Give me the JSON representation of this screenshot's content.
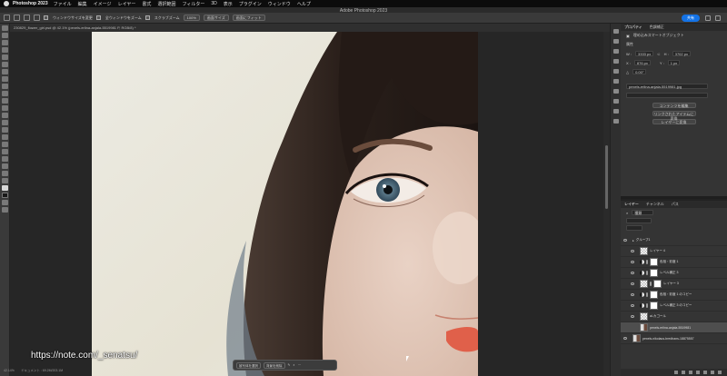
{
  "menubar": {
    "app": "Photoshop 2023",
    "items": [
      "ファイル",
      "編集",
      "イメージ",
      "レイヤー",
      "書式",
      "選択範囲",
      "フィルター",
      "3D",
      "表示",
      "プラグイン",
      "ウィンドウ",
      "ヘルプ"
    ]
  },
  "window": {
    "title": "Adobe Photoshop 2023"
  },
  "options": {
    "resize_windows": "ウィンドウサイズを変更",
    "zoom_all": "全ウィンドウをズーム",
    "scrubby_zoom": "スクラブズーム",
    "zoom_percent": "100%",
    "fit_screen": "画面サイズ",
    "fill_screen": "画面にフィット",
    "share": "共有"
  },
  "document_tab": {
    "label": "230829_flower_girl.psd @ 42.1% (pexels-erlina-anjala-5519981 P, RGB/8) *"
  },
  "canvas": {
    "watermark": "https://note.com/_senatsu/"
  },
  "context_bar": {
    "select_subject": "被写体を選択",
    "remove_bg": "背景を削除"
  },
  "status": {
    "zoom": "42.14%",
    "info": "ドキュメント : 69.2M/203.1M"
  },
  "properties": {
    "tabs": [
      "プロパティ",
      "色調補正"
    ],
    "subtitle": "埋め込みスマートオブジェクト",
    "section": "属性",
    "w_label": "W :",
    "w_value": "3333 px",
    "h_label": "H :",
    "h_value": "3702 px",
    "x_label": "X :",
    "x_value": "876 px",
    "y_label": "Y :",
    "y_value": "1 px",
    "angle_label": "△",
    "angle_value": "0.00°",
    "filename": "pexels-erlina-anjala-5519981.jpg",
    "btn_edit_contents": "コンテンツを編集",
    "btn_convert_linked": "リンクされたアイテムに変換",
    "btn_convert_layers": "レイヤーに変換"
  },
  "layers_panel": {
    "tabs": [
      "レイヤー",
      "チャンネル",
      "パス"
    ],
    "search": "種類",
    "group": "グループ1",
    "items": [
      "レイヤー 4",
      "色相・彩度 1",
      "レベル補正 3",
      "レイヤー 3",
      "色相・彩度 1 のコピー",
      "レベル補正 3 のコピー",
      "ai-カゴール",
      "pexels-erlina-anjala-5519981",
      "pexels-nikolaus-bredhans-18875557"
    ]
  }
}
